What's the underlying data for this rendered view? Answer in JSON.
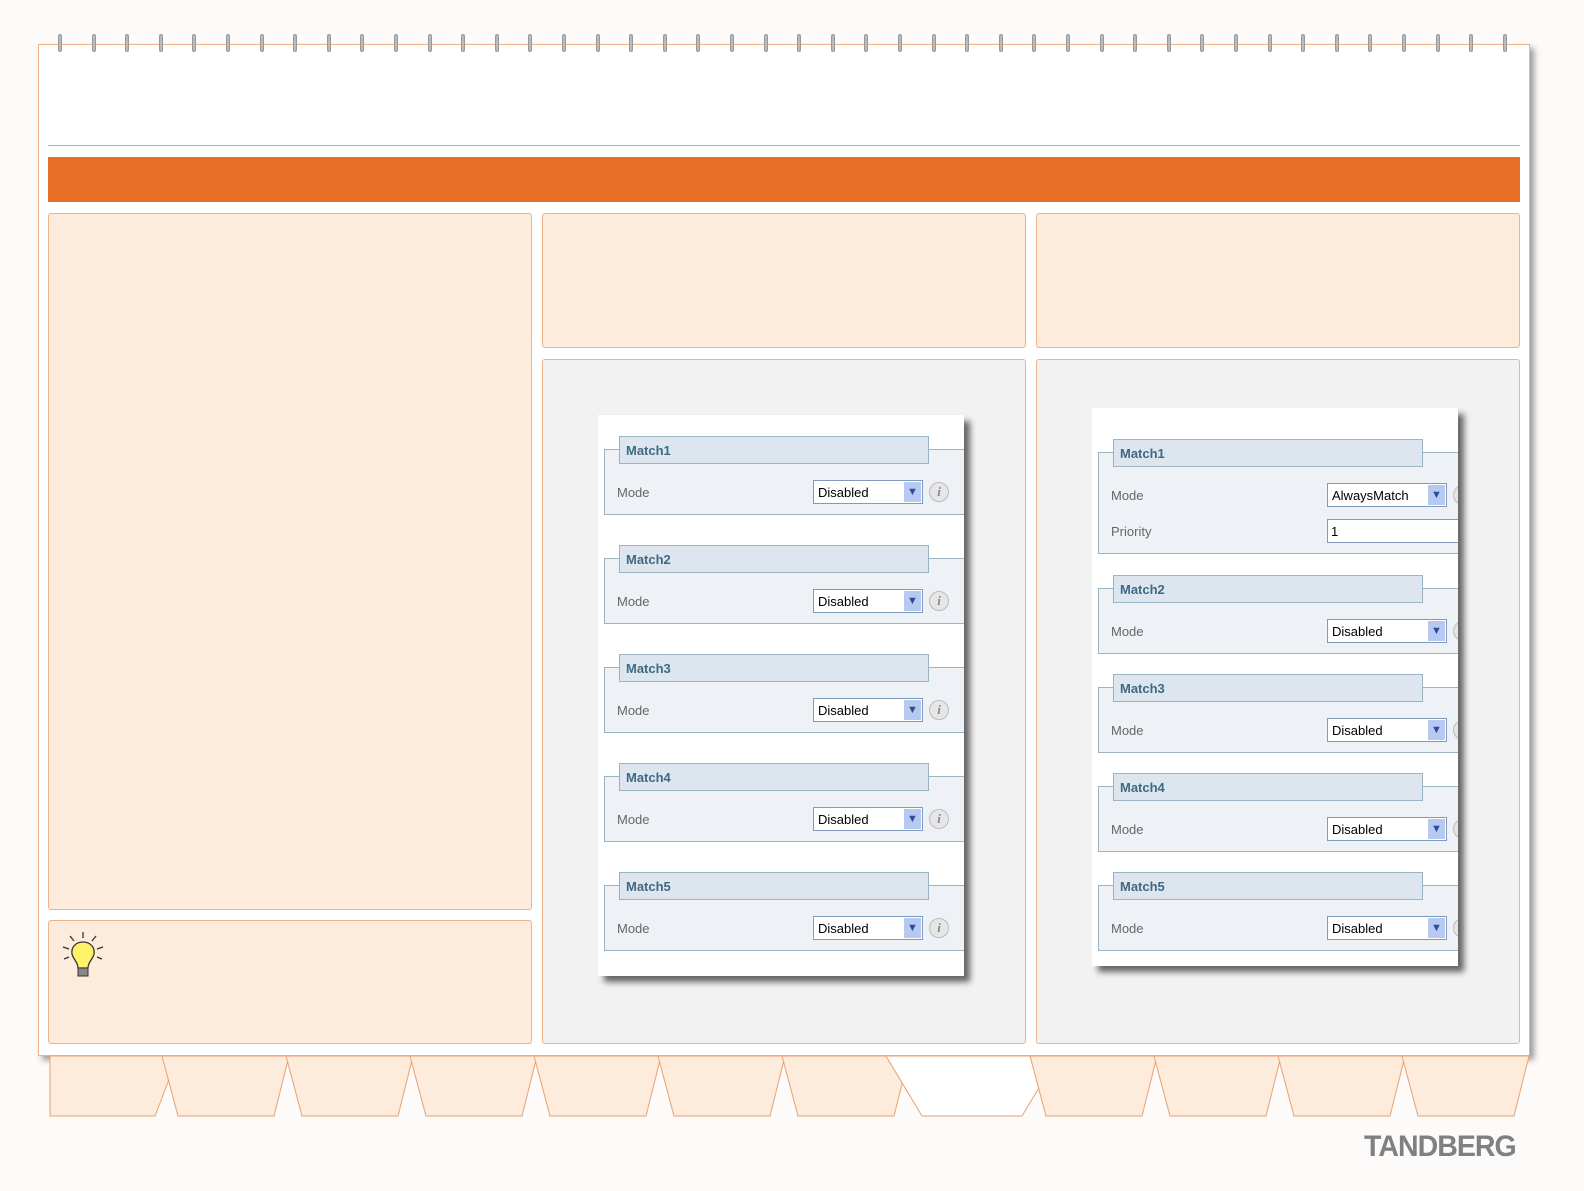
{
  "left_screenshot": {
    "groups": [
      {
        "title": "Match1",
        "fields": [
          {
            "label": "Mode",
            "type": "select",
            "value": "Disabled"
          }
        ]
      },
      {
        "title": "Match2",
        "fields": [
          {
            "label": "Mode",
            "type": "select",
            "value": "Disabled"
          }
        ]
      },
      {
        "title": "Match3",
        "fields": [
          {
            "label": "Mode",
            "type": "select",
            "value": "Disabled"
          }
        ]
      },
      {
        "title": "Match4",
        "fields": [
          {
            "label": "Mode",
            "type": "select",
            "value": "Disabled"
          }
        ]
      },
      {
        "title": "Match5",
        "fields": [
          {
            "label": "Mode",
            "type": "select",
            "value": "Disabled"
          }
        ]
      }
    ]
  },
  "right_screenshot": {
    "groups": [
      {
        "title": "Match1",
        "fields": [
          {
            "label": "Mode",
            "type": "select",
            "value": "AlwaysMatch"
          },
          {
            "label": "Priority",
            "type": "input",
            "value": "1"
          }
        ]
      },
      {
        "title": "Match2",
        "fields": [
          {
            "label": "Mode",
            "type": "select",
            "value": "Disabled"
          }
        ]
      },
      {
        "title": "Match3",
        "fields": [
          {
            "label": "Mode",
            "type": "select",
            "value": "Disabled"
          }
        ]
      },
      {
        "title": "Match4",
        "fields": [
          {
            "label": "Mode",
            "type": "select",
            "value": "Disabled"
          }
        ]
      },
      {
        "title": "Match5",
        "fields": [
          {
            "label": "Mode",
            "type": "select",
            "value": "Disabled"
          }
        ]
      }
    ]
  },
  "icons": {
    "info": "i",
    "dropdown": "▼",
    "tip": "lightbulb-icon"
  },
  "brand": {
    "logo": "TANDBERG"
  },
  "colors": {
    "accent": "#e66e27",
    "panel": "#fdebdb"
  }
}
